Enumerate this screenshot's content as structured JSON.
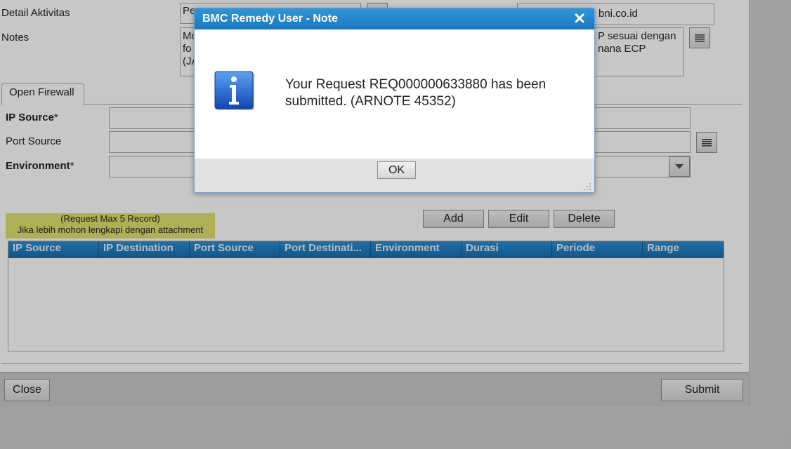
{
  "form": {
    "detail_aktivitas_label": "Detail Aktivitas",
    "notes_label": "Notes",
    "detail_value": "Pe",
    "email_value": "bni.co.id",
    "notes_left_lines": [
      "Mo",
      "fo",
      "(JA"
    ],
    "notes_right_lines": [
      "P sesuai dengan",
      "nana ECP"
    ],
    "tab_label": "Open Firewall",
    "ip_source_label": "IP Source",
    "port_source_label": "Port Source",
    "environment_label": "Environment",
    "required_mark": "*",
    "record_note_line1": "(Request Max 5 Record)",
    "record_note_line2": "Jika lebih mohon lengkapi dengan attachment",
    "add_label": "Add",
    "edit_label": "Edit",
    "delete_label": "Delete",
    "columns": [
      "IP Source",
      "IP Destination",
      "Port Source",
      "Port Destinati...",
      "Environment",
      "Durasi",
      "Periode",
      "Range"
    ],
    "close_label": "Close",
    "submit_label": "Submit"
  },
  "dialog": {
    "title": "BMC Remedy User - Note",
    "message": "Your Request REQ000000633880 has been submitted. (ARNOTE 45352)",
    "ok_label": "OK",
    "icon": "info-icon"
  },
  "colors": {
    "title_bar": "#1f82c8",
    "grid_header": "#1e7fc2",
    "note_highlight": "#e3e06f"
  }
}
